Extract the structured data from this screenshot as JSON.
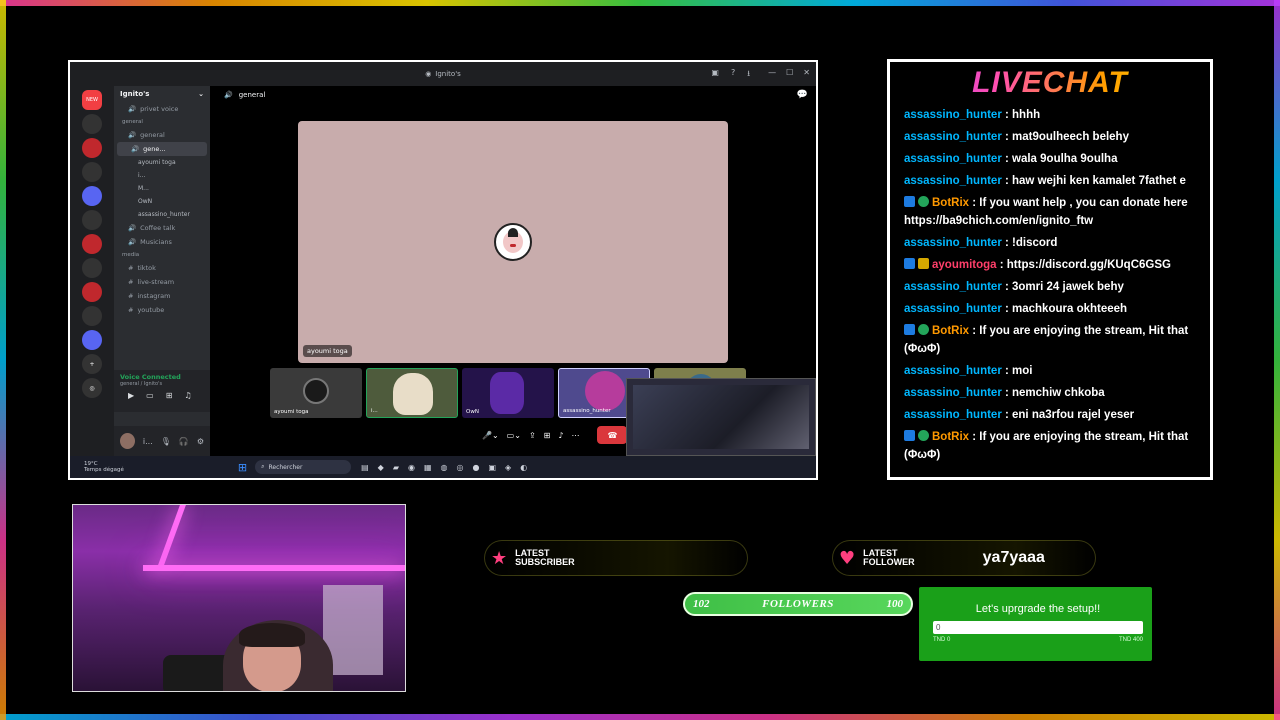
{
  "discord": {
    "window_title": "Ignito's",
    "guild_name": "Ignito's",
    "channel_name": "general",
    "channels": [
      {
        "label": "privet voice",
        "type": "voice"
      },
      {
        "label": "general",
        "type": "category"
      },
      {
        "label": "general",
        "type": "voice"
      },
      {
        "label": "gene...",
        "type": "voice-active"
      }
    ],
    "voice_users": [
      "ayoumi toga",
      "i...",
      "M...",
      "OwN",
      "assassino_hunter"
    ],
    "channels2": [
      {
        "label": "Coffee talk",
        "type": "voice"
      },
      {
        "label": "Musicians",
        "type": "voice"
      },
      {
        "label": "media",
        "type": "category"
      },
      {
        "label": "tiktok",
        "type": "text"
      },
      {
        "label": "live-stream",
        "type": "text"
      },
      {
        "label": "instagram",
        "type": "text"
      },
      {
        "label": "youtube",
        "type": "text"
      }
    ],
    "voice_connected": "Voice Connected",
    "voice_sub": "general / Ignito's",
    "user_short": "i...",
    "stage_user": "ayoumi toga",
    "tiles": [
      {
        "label": "ayoumi toga"
      },
      {
        "label": "i..."
      },
      {
        "label": "OwN"
      },
      {
        "label": "assassino_hunter"
      },
      {
        "label": ""
      }
    ],
    "taskbar": {
      "temp": "19°C",
      "weather": "Temps dégagé",
      "search_placeholder": "Rechercher"
    }
  },
  "chat": {
    "title": "LIVECHAT",
    "messages": [
      {
        "user": "assassino_hunter",
        "text": " : hhhh",
        "kind": "user"
      },
      {
        "user": "assassino_hunter",
        "text": " : mat9oulheech belehy",
        "kind": "user"
      },
      {
        "user": "assassino_hunter",
        "text": " : wala 9oulha 9oulha",
        "kind": "user"
      },
      {
        "user": "assassino_hunter",
        "text": " : haw wejhi ken kamalet 7fathet e",
        "kind": "user"
      },
      {
        "user": "BotRix",
        "text": " : If you want help , you can donate here https://ba9chich.com/en/ignito_ftw",
        "kind": "bot"
      },
      {
        "user": "assassino_hunter",
        "text": " : !discord",
        "kind": "user"
      },
      {
        "user": "ayoumitoga",
        "text": " : https://discord.gg/KUqC6GSG",
        "kind": "pink"
      },
      {
        "user": "assassino_hunter",
        "text": " : 3omri 24 jawek behy",
        "kind": "user"
      },
      {
        "user": "assassino_hunter",
        "text": " : machkoura okhteeeh",
        "kind": "user"
      },
      {
        "user": "BotRix",
        "text": " : If you are enjoying the stream, Hit that (ΦωΦ)",
        "kind": "bot"
      },
      {
        "user": "assassino_hunter",
        "text": " : moi",
        "kind": "user"
      },
      {
        "user": "assassino_hunter",
        "text": " : nemchiw chkoba",
        "kind": "user"
      },
      {
        "user": "assassino_hunter",
        "text": " : eni na3rfou rajel yeser",
        "kind": "user"
      },
      {
        "user": "BotRix",
        "text": " : If you are enjoying the stream, Hit that (ΦωΦ)",
        "kind": "bot"
      }
    ]
  },
  "latest_subscriber": {
    "label_1": "LATEST",
    "label_2": "SUBSCRIBER",
    "value": ""
  },
  "latest_follower": {
    "label_1": "LATEST",
    "label_2": "FOLLOWER",
    "value": "ya7yaaa"
  },
  "follower_goal": {
    "current": "102",
    "label": "FOLLOWERS",
    "target": "100",
    "progress": 1.0
  },
  "donation_goal": {
    "title": "Let's uprgrade the setup!!",
    "amount": "0",
    "min": "TND 0",
    "max": "TND 400",
    "progress": 0
  },
  "colors": {
    "username": "#00b7ff",
    "bot": "#ff9900",
    "goal_green": "#1aa019",
    "heart": "#ff3f7f"
  }
}
